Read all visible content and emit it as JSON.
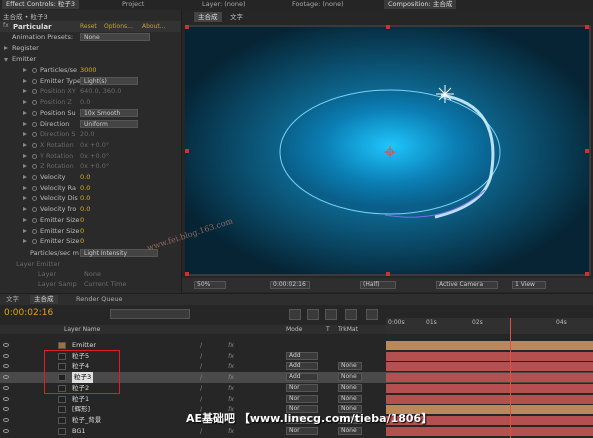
{
  "colors": {
    "accent": "#d8b020",
    "bar_red": "#b55050",
    "bar_tan": "#b88a5a",
    "select": "#e0e0e0",
    "canvas": "#0b3348"
  },
  "tabs_top": [
    {
      "label": "Effect Controls: 粒子3"
    },
    {
      "label": "Project"
    },
    {
      "label": "Layer: (none)"
    },
    {
      "label": "Footage: (none)"
    },
    {
      "label": "Composition: 主合成"
    }
  ],
  "ec": {
    "breadcrumb": "主合成 • 粒子3",
    "effect_name": "Particular",
    "reset": "Reset",
    "options": "Options...",
    "about": "About...",
    "presets_label": "Animation Presets:",
    "presets_value": "None",
    "register": "Register",
    "emitter": "Emitter",
    "rows": [
      {
        "label": "Particles/se",
        "value": "3000",
        "style": "yel"
      },
      {
        "label": "Emitter Type",
        "value": "Light(s)",
        "style": "dd"
      },
      {
        "label": "Position XY",
        "value": "640.0, 360.0",
        "style": "dim"
      },
      {
        "label": "Position Z",
        "value": "0.0",
        "style": "dim"
      },
      {
        "label": "Position Su",
        "value": "10x Smooth",
        "style": "dd"
      },
      {
        "label": "Direction",
        "value": "Uniform",
        "style": "dd"
      },
      {
        "label": "Direction S",
        "value": "20.0",
        "style": "dim"
      },
      {
        "label": "X Rotation",
        "value": "0x +0.0°",
        "style": "dim"
      },
      {
        "label": "Y Rotation",
        "value": "0x +0.0°",
        "style": "dim"
      },
      {
        "label": "Z Rotation",
        "value": "0x +0.0°",
        "style": "dim"
      },
      {
        "label": "Velocity",
        "value": "0.0",
        "style": "yel"
      },
      {
        "label": "Velocity Ra",
        "value": "0.0",
        "style": "yel"
      },
      {
        "label": "Velocity Dis",
        "value": "0.0",
        "style": "yel"
      },
      {
        "label": "Velocity fro",
        "value": "0.0",
        "style": "yel"
      },
      {
        "label": "Emitter Size",
        "value": "0",
        "style": "yel"
      },
      {
        "label": "Emitter Size",
        "value": "0",
        "style": "yel"
      },
      {
        "label": "Emitter Size",
        "value": "0",
        "style": "yel"
      }
    ],
    "psm_label": "Particles/sec m",
    "psm_value": "Light Intensity",
    "layer_emitter": "Layer Emitter",
    "layer_label": "Layer",
    "layer_value": "None",
    "layer_samp_label": "Layer Samp",
    "layer_samp_value": "Current Time"
  },
  "comp": {
    "tab_main": "主合成",
    "tab_text": "文字",
    "zoom": "50%",
    "time": "0:00:02:16",
    "res": "(Half)",
    "camera": "Active Camera",
    "view": "1 View"
  },
  "watermark_site": "www.fei.blog.163.com",
  "timeline": {
    "tabs": [
      {
        "label": "文字"
      },
      {
        "label": "主合成"
      },
      {
        "label": "Render Queue"
      }
    ],
    "timecode": "0:00:02:16",
    "search_placeholder": "",
    "col_layer": "Layer Name",
    "col_mode": "Mode",
    "col_t": "T",
    "col_trkmat": "TrkMat",
    "ruler": [
      "0:00s",
      "01s",
      "02s",
      "04s"
    ],
    "playhead_fraction": 0.6,
    "layers": [
      {
        "name": "Emitter",
        "mode": "",
        "trk": "",
        "bar": "tan"
      },
      {
        "name": "粒子5",
        "mode": "Add",
        "trk": "",
        "bar": "red"
      },
      {
        "name": "粒子4",
        "mode": "Add",
        "trk": "None",
        "bar": "red"
      },
      {
        "name": "粒子3",
        "mode": "Add",
        "trk": "None",
        "bar": "red"
      },
      {
        "name": "粒子2",
        "mode": "Nor",
        "trk": "None",
        "bar": "red"
      },
      {
        "name": "粒子1",
        "mode": "Nor",
        "trk": "None",
        "bar": "red"
      },
      {
        "name": "[辉形]",
        "mode": "Nor",
        "trk": "None",
        "bar": "tan"
      },
      {
        "name": "粒子_背景",
        "mode": "Nor",
        "trk": "None",
        "bar": "red"
      },
      {
        "name": "BG1",
        "mode": "Nor",
        "trk": "None",
        "bar": "red"
      }
    ]
  },
  "banner": "AE基础吧 【www.linecg.com/tieba/1806】"
}
